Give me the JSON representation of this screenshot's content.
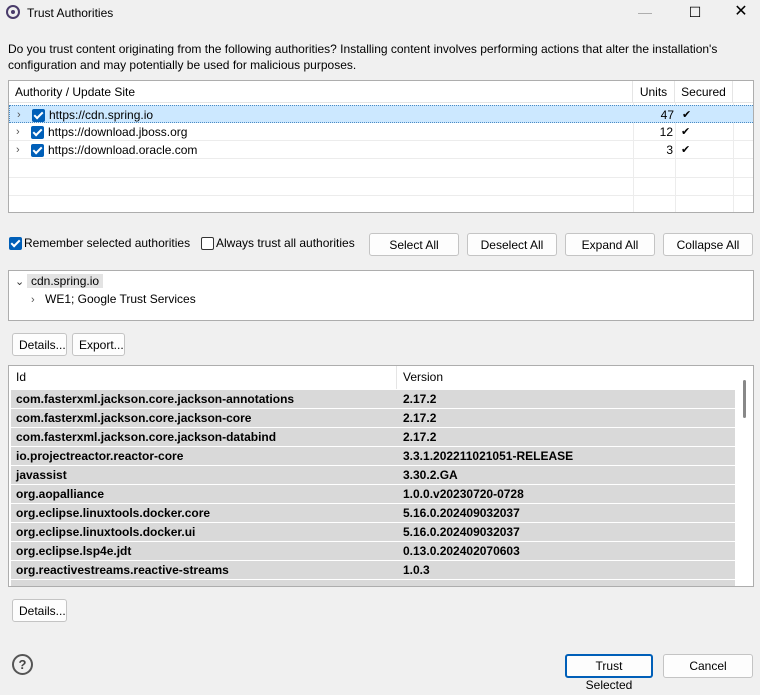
{
  "window": {
    "title": "Trust Authorities",
    "controls": {
      "minimize": "—",
      "maximize": "☐",
      "close": "✕"
    }
  },
  "description": "Do you trust content originating from the following authorities?  Installing content involves performing actions that alter the installation's configuration and may potentially be used for malicious purposes.",
  "authorities_table": {
    "headers": {
      "site": "Authority / Update Site",
      "units": "Units",
      "secured": "Secured"
    },
    "rows": [
      {
        "url": "https://cdn.spring.io",
        "units": "47",
        "secured": "✔",
        "checked": true,
        "selected": true
      },
      {
        "url": "https://download.jboss.org",
        "units": "12",
        "secured": "✔",
        "checked": true,
        "selected": false
      },
      {
        "url": "https://download.oracle.com",
        "units": "3",
        "secured": "✔",
        "checked": true,
        "selected": false
      }
    ]
  },
  "options": {
    "remember_label": "Remember selected authorities",
    "remember_checked": true,
    "always_trust_label": "Always trust all authorities",
    "always_trust_checked": false,
    "select_all": "Select All",
    "deselect_all": "Deselect All",
    "expand_all": "Expand All",
    "collapse_all": "Collapse All"
  },
  "certificate_tree": {
    "root": "cdn.spring.io",
    "child": "WE1; Google Trust Services"
  },
  "cert_buttons": {
    "details": "Details...",
    "export": "Export..."
  },
  "units_table": {
    "headers": {
      "id": "Id",
      "version": "Version"
    },
    "rows": [
      {
        "id": "com.fasterxml.jackson.core.jackson-annotations",
        "version": "2.17.2"
      },
      {
        "id": "com.fasterxml.jackson.core.jackson-core",
        "version": "2.17.2"
      },
      {
        "id": "com.fasterxml.jackson.core.jackson-databind",
        "version": "2.17.2"
      },
      {
        "id": "io.projectreactor.reactor-core",
        "version": "3.3.1.202211021051-RELEASE"
      },
      {
        "id": "javassist",
        "version": "3.30.2.GA"
      },
      {
        "id": "org.aopalliance",
        "version": "1.0.0.v20230720-0728"
      },
      {
        "id": "org.eclipse.linuxtools.docker.core",
        "version": "5.16.0.202409032037"
      },
      {
        "id": "org.eclipse.linuxtools.docker.ui",
        "version": "5.16.0.202409032037"
      },
      {
        "id": "org.eclipse.lsp4e.jdt",
        "version": "0.13.0.202402070603"
      },
      {
        "id": "org.reactivestreams.reactive-streams",
        "version": "1.0.3"
      }
    ]
  },
  "units_details_button": "Details...",
  "footer": {
    "help_icon": "?",
    "trust_selected": "Trust Selected",
    "cancel": "Cancel"
  }
}
